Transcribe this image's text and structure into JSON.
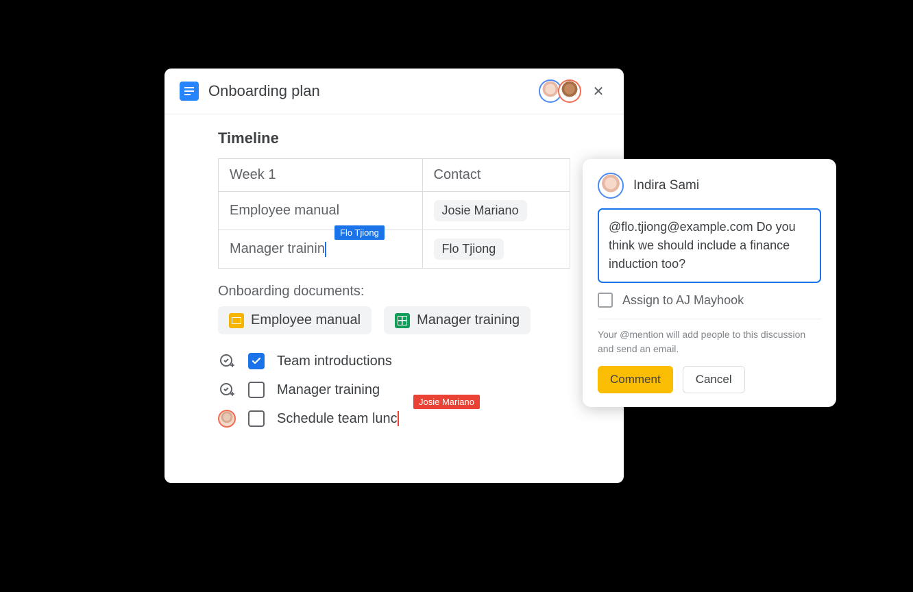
{
  "header": {
    "doc_title": "Onboarding plan",
    "close_glyph": "✕"
  },
  "timeline": {
    "heading": "Timeline",
    "col1_header": "Week 1",
    "col2_header": "Contact",
    "rows": [
      {
        "label": "Employee manual",
        "contact": "Josie Mariano"
      },
      {
        "label": "Manager trainin",
        "contact": "Flo Tjiong"
      }
    ],
    "live_cursor_blue": "Flo Tjiong"
  },
  "documents": {
    "heading": "Onboarding documents:",
    "items": [
      {
        "icon": "slides",
        "label": "Employee manual"
      },
      {
        "icon": "sheets",
        "label": "Manager training"
      }
    ]
  },
  "checklist": {
    "items": [
      {
        "checked": true,
        "label": "Team introductions"
      },
      {
        "checked": false,
        "label": "Manager training"
      },
      {
        "checked": false,
        "label": "Schedule team lunc"
      }
    ],
    "live_cursor_red": "Josie Mariano"
  },
  "comment": {
    "author": "Indira Sami",
    "text": "@flo.tjiong@example.com Do you think we should include a finance induction too?",
    "assign_label": "Assign to AJ Mayhook",
    "hint": "Your @mention will add people to this discussion and send an email.",
    "primary_btn": "Comment",
    "secondary_btn": "Cancel"
  }
}
